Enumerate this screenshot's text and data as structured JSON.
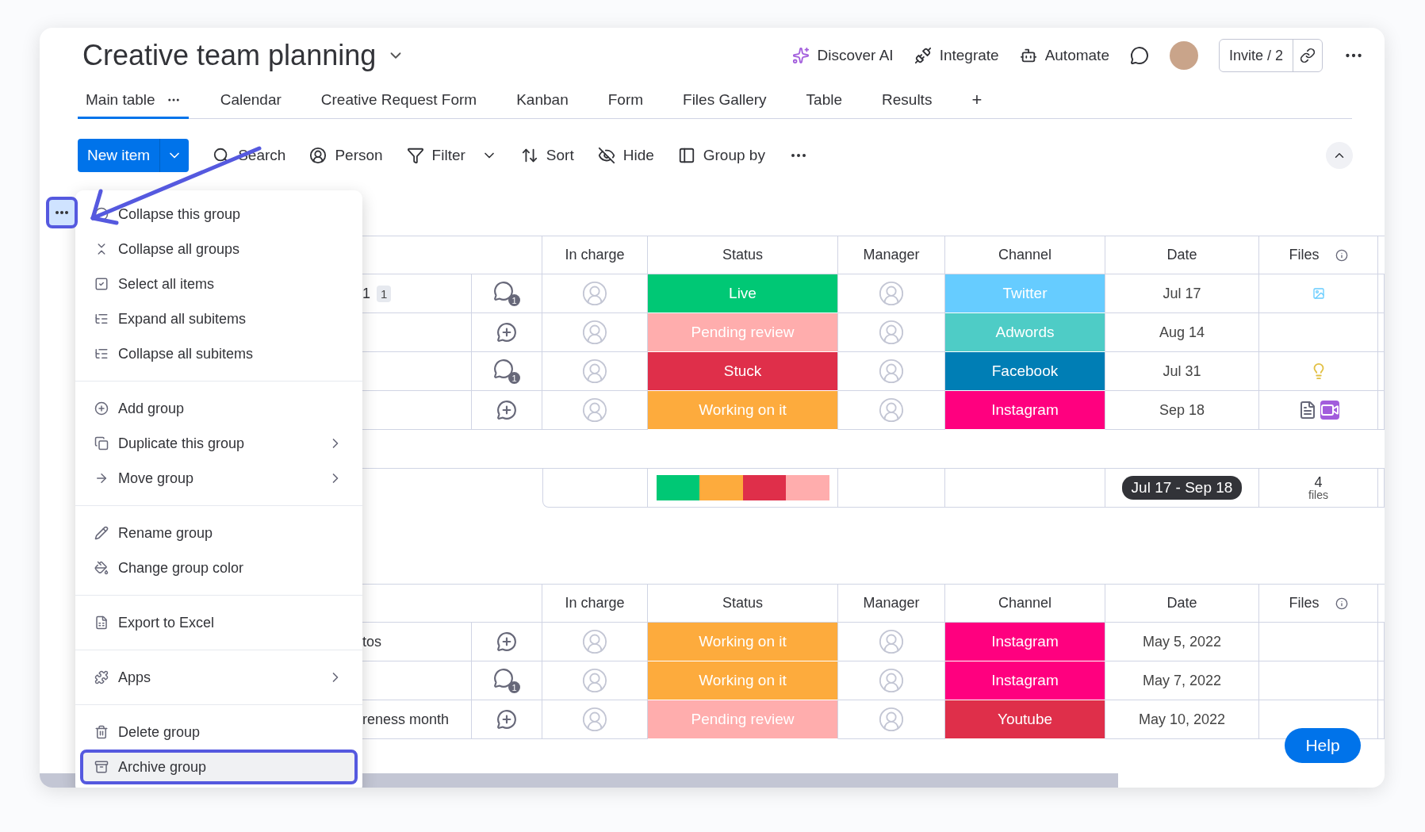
{
  "board": {
    "title": "Creative team planning"
  },
  "top_actions": [
    {
      "label": "Discover AI"
    },
    {
      "label": "Integrate"
    },
    {
      "label": "Automate"
    }
  ],
  "invite": {
    "label": "Invite / 2"
  },
  "tabs": [
    {
      "label": "Main table",
      "selected": true
    },
    {
      "label": "Calendar",
      "selected": false
    },
    {
      "label": "Creative Request Form",
      "selected": false
    },
    {
      "label": "Kanban",
      "selected": false
    },
    {
      "label": "Form",
      "selected": false
    },
    {
      "label": "Files Gallery",
      "selected": false
    },
    {
      "label": "Table",
      "selected": false
    },
    {
      "label": "Results",
      "selected": false
    }
  ],
  "add_view": "+",
  "toolbar": {
    "new_item": "New item",
    "tools": [
      {
        "label": "Search",
        "dropdown": false
      },
      {
        "label": "Person",
        "dropdown": false
      },
      {
        "label": "Filter",
        "dropdown": true
      },
      {
        "label": "Sort",
        "dropdown": false
      },
      {
        "label": "Hide",
        "dropdown": false
      },
      {
        "label": "Group by",
        "dropdown": false
      }
    ]
  },
  "group_menu": {
    "sections": [
      [
        {
          "label": "Collapse this group",
          "submenu": false,
          "highlighted": false
        },
        {
          "label": "Collapse all groups",
          "submenu": false,
          "highlighted": false
        },
        {
          "label": "Select all items",
          "submenu": false,
          "highlighted": false
        },
        {
          "label": "Expand all subitems",
          "submenu": false,
          "highlighted": false
        },
        {
          "label": "Collapse all subitems",
          "submenu": false,
          "highlighted": false
        }
      ],
      [
        {
          "label": "Add group",
          "submenu": false,
          "highlighted": false
        },
        {
          "label": "Duplicate this group",
          "submenu": true,
          "highlighted": false
        },
        {
          "label": "Move group",
          "submenu": true,
          "highlighted": false
        }
      ],
      [
        {
          "label": "Rename group",
          "submenu": false,
          "highlighted": false
        },
        {
          "label": "Change group color",
          "submenu": false,
          "highlighted": false
        }
      ],
      [
        {
          "label": "Export to Excel",
          "submenu": false,
          "highlighted": false
        }
      ],
      [
        {
          "label": "Apps",
          "submenu": true,
          "highlighted": false
        }
      ],
      [
        {
          "label": "Delete group",
          "submenu": false,
          "highlighted": false
        },
        {
          "label": "Archive group",
          "submenu": false,
          "highlighted": true
        }
      ]
    ]
  },
  "groups": [
    {
      "columns": [
        {
          "label": "In charge",
          "info": false
        },
        {
          "label": "Status",
          "info": false
        },
        {
          "label": "Manager",
          "info": false
        },
        {
          "label": "Channel",
          "info": false
        },
        {
          "label": "Date",
          "info": false
        },
        {
          "label": "Files",
          "info": true
        }
      ],
      "rows": [
        {
          "name": "1",
          "subitems": "1",
          "updates": "1",
          "status": {
            "label": "Live",
            "color": "#00c875"
          },
          "channel": {
            "label": "Twitter",
            "color": "#66ccff"
          },
          "date": "Jul 17",
          "files": [
            {
              "kind": "image"
            }
          ]
        },
        {
          "status": {
            "label": "Pending review",
            "color": "#ffadad"
          },
          "channel": {
            "label": "Adwords",
            "color": "#4eccc6"
          },
          "date": "Aug 14"
        },
        {
          "updates": "1",
          "status": {
            "label": "Stuck",
            "color": "#df2f4a"
          },
          "channel": {
            "label": "Facebook",
            "color": "#007eb5"
          },
          "date": "Jul 31",
          "files": [
            {
              "kind": "bulb"
            }
          ]
        },
        {
          "status": {
            "label": "Working on it",
            "color": "#fdab3d"
          },
          "channel": {
            "label": "Instagram",
            "color": "#ff007f"
          },
          "date": "Sep 18",
          "files": [
            {
              "kind": "document"
            },
            {
              "kind": "video"
            }
          ]
        }
      ],
      "summary": {
        "status_segments": [
          {
            "color": "#00c875"
          },
          {
            "color": "#fdab3d"
          },
          {
            "color": "#df2f4a"
          },
          {
            "color": "#ffadad"
          }
        ],
        "date_range": "Jul 17 - Sep 18",
        "files_count": "4",
        "files_unit": "files"
      }
    },
    {
      "columns": [
        {
          "label": "In charge",
          "info": false
        },
        {
          "label": "Status",
          "info": false
        },
        {
          "label": "Manager",
          "info": false
        },
        {
          "label": "Channel",
          "info": false
        },
        {
          "label": "Date",
          "info": false
        },
        {
          "label": "Files",
          "info": true
        }
      ],
      "rows": [
        {
          "name": "tos",
          "status": {
            "label": "Working on it",
            "color": "#fdab3d"
          },
          "channel": {
            "label": "Instagram",
            "color": "#ff007f"
          },
          "date": "May 5, 2022"
        },
        {
          "updates": "1",
          "status": {
            "label": "Working on it",
            "color": "#fdab3d"
          },
          "channel": {
            "label": "Instagram",
            "color": "#ff007f"
          },
          "date": "May 7, 2022"
        },
        {
          "name": "reness month",
          "status": {
            "label": "Pending review",
            "color": "#ffadad"
          },
          "channel": {
            "label": "Youtube",
            "color": "#df2f4a"
          },
          "date": "May 10, 2022"
        }
      ]
    }
  ],
  "help": "Help"
}
